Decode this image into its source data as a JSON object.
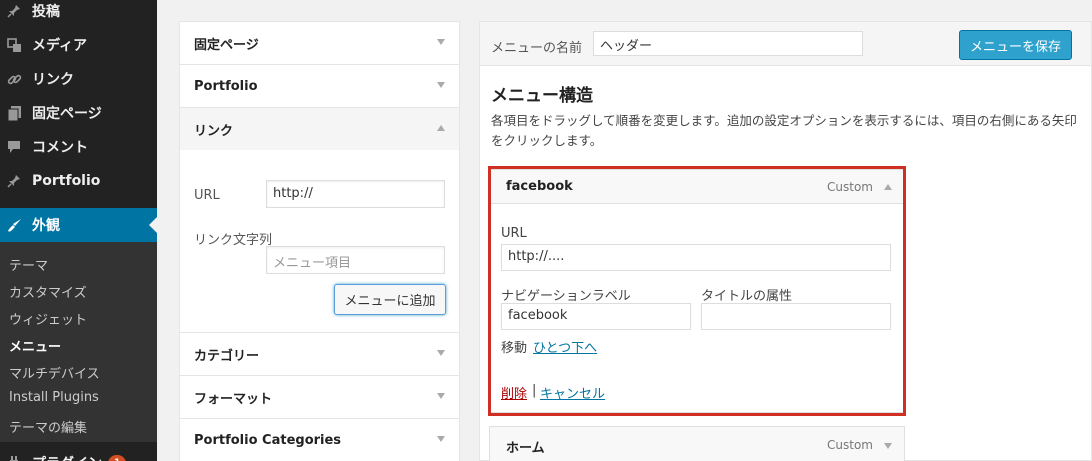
{
  "sidebar": {
    "items": [
      {
        "label": "投稿",
        "icon": "pin-icon"
      },
      {
        "label": "メディア",
        "icon": "media-icon"
      },
      {
        "label": "リンク",
        "icon": "link-icon"
      },
      {
        "label": "固定ページ",
        "icon": "page-icon"
      },
      {
        "label": "コメント",
        "icon": "comment-icon"
      },
      {
        "label": "Portfolio",
        "icon": "pin-icon"
      },
      {
        "label": "外観",
        "icon": "appearance-icon"
      }
    ],
    "submenu": [
      "テーマ",
      "カスタマイズ",
      "ウィジェット",
      "メニュー",
      "マルチデバイス",
      "Install Plugins",
      "テーマの編集"
    ],
    "plugins": {
      "label": "プラグイン",
      "badge": "1"
    }
  },
  "left_panel": {
    "sections": {
      "pages": "固定ページ",
      "portfolio": "Portfolio",
      "links": "リンク",
      "categories": "カテゴリー",
      "formats": "フォーマット",
      "portfolio_categories": "Portfolio Categories"
    },
    "link_form": {
      "url_label": "URL",
      "url_value": "http://",
      "text_label": "リンク文字列",
      "text_placeholder": "メニュー項目",
      "add_button": "メニューに追加"
    }
  },
  "right_panel": {
    "menu_name_label": "メニューの名前",
    "menu_name_value": "ヘッダー",
    "save_button": "メニューを保存",
    "structure_title": "メニュー構造",
    "description": "各項目をドラッグして順番を変更します。追加の設定オプションを表示するには、項目の右側にある矢印をクリックします。",
    "items": [
      {
        "title": "facebook",
        "type": "Custom",
        "url_label": "URL",
        "url_value": "http://....",
        "nav_label": "ナビゲーションラベル",
        "nav_value": "facebook",
        "title_attr_label": "タイトルの属性",
        "title_attr_value": "",
        "move_label": "移動",
        "move_link": "ひとつ下へ",
        "delete": "削除",
        "separator": "|",
        "cancel": "キャンセル"
      },
      {
        "title": "ホーム",
        "type": "Custom"
      }
    ]
  },
  "colors": {
    "accent": "#0074a2",
    "save_button": "#2ea2cc",
    "highlight": "#d03024"
  }
}
